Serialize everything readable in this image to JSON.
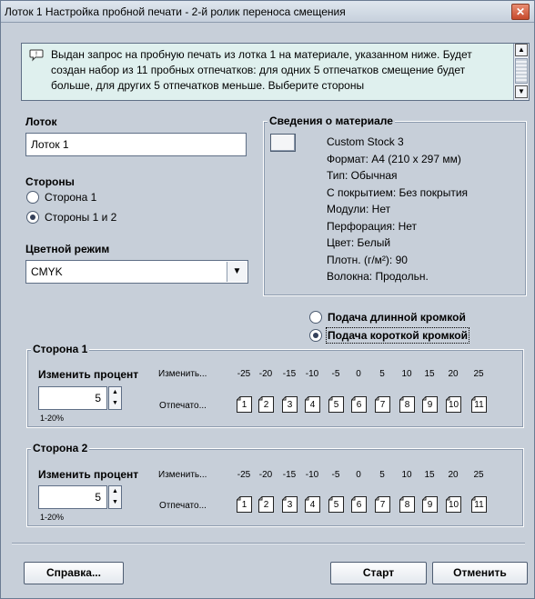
{
  "window": {
    "title": "Лоток 1 Настройка пробной печати - 2-й ролик переноса смещения",
    "close_icon": "close-icon"
  },
  "info": {
    "icon": "speech-bubble-icon",
    "text": "Выдан запрос на пробную печать из лотка 1 на материале, указанном ниже.  Будет создан набор из 11 пробных отпечатков: для одних 5 отпечатков смещение будет больше, для других 5 отпечатков меньше.  Выберите стороны"
  },
  "tray": {
    "label": "Лоток",
    "value": "Лоток 1"
  },
  "sides": {
    "label": "Стороны",
    "options": [
      {
        "label": "Сторона 1",
        "selected": false
      },
      {
        "label": "Стороны 1 и 2",
        "selected": true
      }
    ]
  },
  "color_mode": {
    "label": "Цветной режим",
    "value": "CMYK"
  },
  "material": {
    "title": "Сведения о материале",
    "lines": [
      "Custom Stock 3",
      "Формат: A4 (210 x 297 мм)",
      "Тип:  Обычная",
      "С покрытием: Без покрытия",
      "Модули: Нет",
      "Перфорация: Нет",
      "Цвет: Белый",
      "Плотн. (г/м²): 90",
      "Волокна: Продольн."
    ]
  },
  "feed": {
    "options": [
      {
        "label": "Подача длинной кромкой",
        "selected": false
      },
      {
        "label": "Подача короткой кромкой",
        "selected": true
      }
    ]
  },
  "side1": {
    "title": "Сторона 1",
    "change_label": "Изменить процент",
    "value": "5",
    "range": "1-20%",
    "change_row_label": "Изменить...",
    "prints_row_label": "Отпечато...",
    "percents": [
      "-25",
      "-20",
      "-15",
      "-10",
      "-5",
      "0",
      "5",
      "10",
      "15",
      "20",
      "25"
    ],
    "sheets": [
      "1",
      "2",
      "3",
      "4",
      "5",
      "6",
      "7",
      "8",
      "9",
      "10",
      "11"
    ]
  },
  "side2": {
    "title": "Сторона 2",
    "change_label": "Изменить процент",
    "value": "5",
    "range": "1-20%",
    "change_row_label": "Изменить...",
    "prints_row_label": "Отпечато...",
    "percents": [
      "-25",
      "-20",
      "-15",
      "-10",
      "-5",
      "0",
      "5",
      "10",
      "15",
      "20",
      "25"
    ],
    "sheets": [
      "1",
      "2",
      "3",
      "4",
      "5",
      "6",
      "7",
      "8",
      "9",
      "10",
      "11"
    ]
  },
  "footer": {
    "help": "Справка...",
    "start": "Старт",
    "cancel": "Отменить"
  }
}
